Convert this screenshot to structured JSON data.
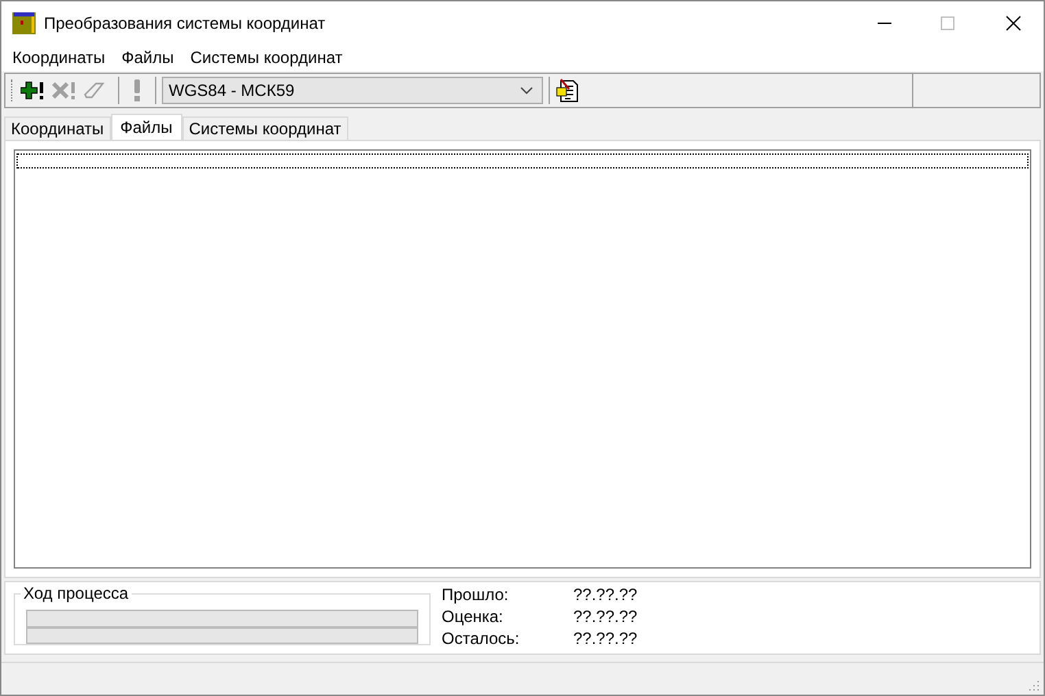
{
  "window": {
    "title": "Преобразования системы координат"
  },
  "menu": [
    "Координаты",
    "Файлы",
    "Системы координат"
  ],
  "toolbar": [
    {
      "kind": "add",
      "disabled": false
    },
    {
      "kind": "delete",
      "disabled": true
    },
    {
      "kind": "erase",
      "disabled": true
    },
    {
      "kind": "separator"
    },
    {
      "kind": "run",
      "disabled": true
    },
    {
      "kind": "separator"
    }
  ],
  "transform_select": {
    "value": "WGS84 - МСК59"
  },
  "tabs": [
    {
      "label": "Координаты",
      "selected": false
    },
    {
      "label": "Файлы",
      "selected": true
    },
    {
      "label": "Системы координат",
      "selected": false
    }
  ],
  "progress": {
    "title": "Ход процесса",
    "bars": [
      {
        "level": 0
      },
      {
        "level": 0
      }
    ],
    "times": [
      {
        "label": "Прошло:",
        "value": "??.??.??"
      },
      {
        "label": "Оценка:",
        "value": "??.??.??"
      },
      {
        "label": "Осталось:",
        "value": "??.??.??"
      }
    ]
  }
}
